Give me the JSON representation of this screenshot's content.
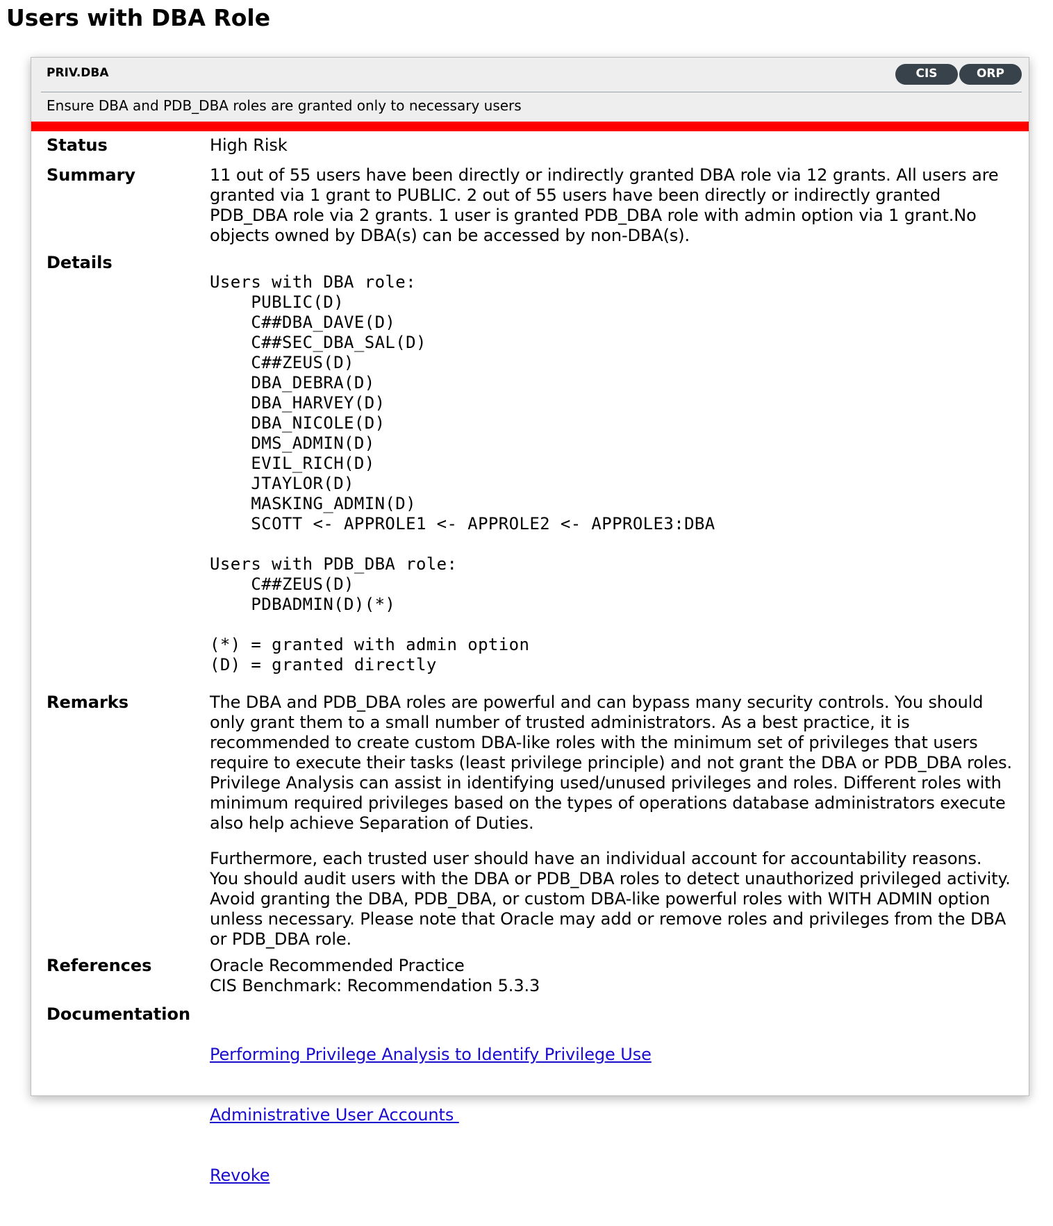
{
  "page": {
    "title": "Users with DBA Role"
  },
  "finding": {
    "id": "PRIV.DBA",
    "tags": [
      "CIS",
      "ORP"
    ],
    "title": "Ensure DBA and PDB_DBA roles are granted only to necessary users",
    "risk_color": "#ff0000",
    "tag_color": "#37424b"
  },
  "labels": {
    "status": "Status",
    "summary": "Summary",
    "details": "Details",
    "remarks": "Remarks",
    "references": "References",
    "documentation": "Documentation"
  },
  "status": "High Risk",
  "summary": "11 out of 55 users have been directly or indirectly granted DBA role via 12 grants. All users are granted via 1 grant to PUBLIC. 2 out of 55 users have been directly or indirectly granted PDB_DBA role via 2 grants. 1 user is granted PDB_DBA role with admin option via 1 grant.No objects owned by DBA(s) can be accessed by non-DBA(s).",
  "details": "Users with DBA role:\n    PUBLIC(D)\n    C##DBA_DAVE(D)\n    C##SEC_DBA_SAL(D)\n    C##ZEUS(D)\n    DBA_DEBRA(D)\n    DBA_HARVEY(D)\n    DBA_NICOLE(D)\n    DMS_ADMIN(D)\n    EVIL_RICH(D)\n    JTAYLOR(D)\n    MASKING_ADMIN(D)\n    SCOTT <- APPROLE1 <- APPROLE2 <- APPROLE3:DBA\n\nUsers with PDB_DBA role:\n    C##ZEUS(D)\n    PDBADMIN(D)(*)\n\n(*) = granted with admin option\n(D) = granted directly",
  "remarks": [
    "The DBA and PDB_DBA roles are powerful and can bypass many security controls. You should only grant them to a small number of trusted administrators. As a best practice, it is recommended to create custom DBA-like roles with the minimum set of privileges that users require to execute their tasks (least privilege principle) and not grant the DBA or PDB_DBA roles. Privilege Analysis can assist in identifying used/unused privileges and roles. Different roles with minimum required privileges based on the types of operations database administrators execute also help achieve Separation of Duties.",
    "Furthermore, each trusted user should have an individual account for accountability reasons. You should audit users with the DBA or PDB_DBA roles to detect unauthorized privileged activity. Avoid granting the DBA, PDB_DBA, or custom DBA-like powerful roles with WITH ADMIN option unless necessary. Please note that Oracle may add or remove roles and privileges from the DBA or PDB_DBA role."
  ],
  "references": [
    "Oracle Recommended Practice",
    "CIS Benchmark: Recommendation 5.3.3"
  ],
  "documentation": [
    "Performing Privilege Analysis to Identify Privilege Use",
    "Administrative User Accounts ",
    "Revoke"
  ]
}
